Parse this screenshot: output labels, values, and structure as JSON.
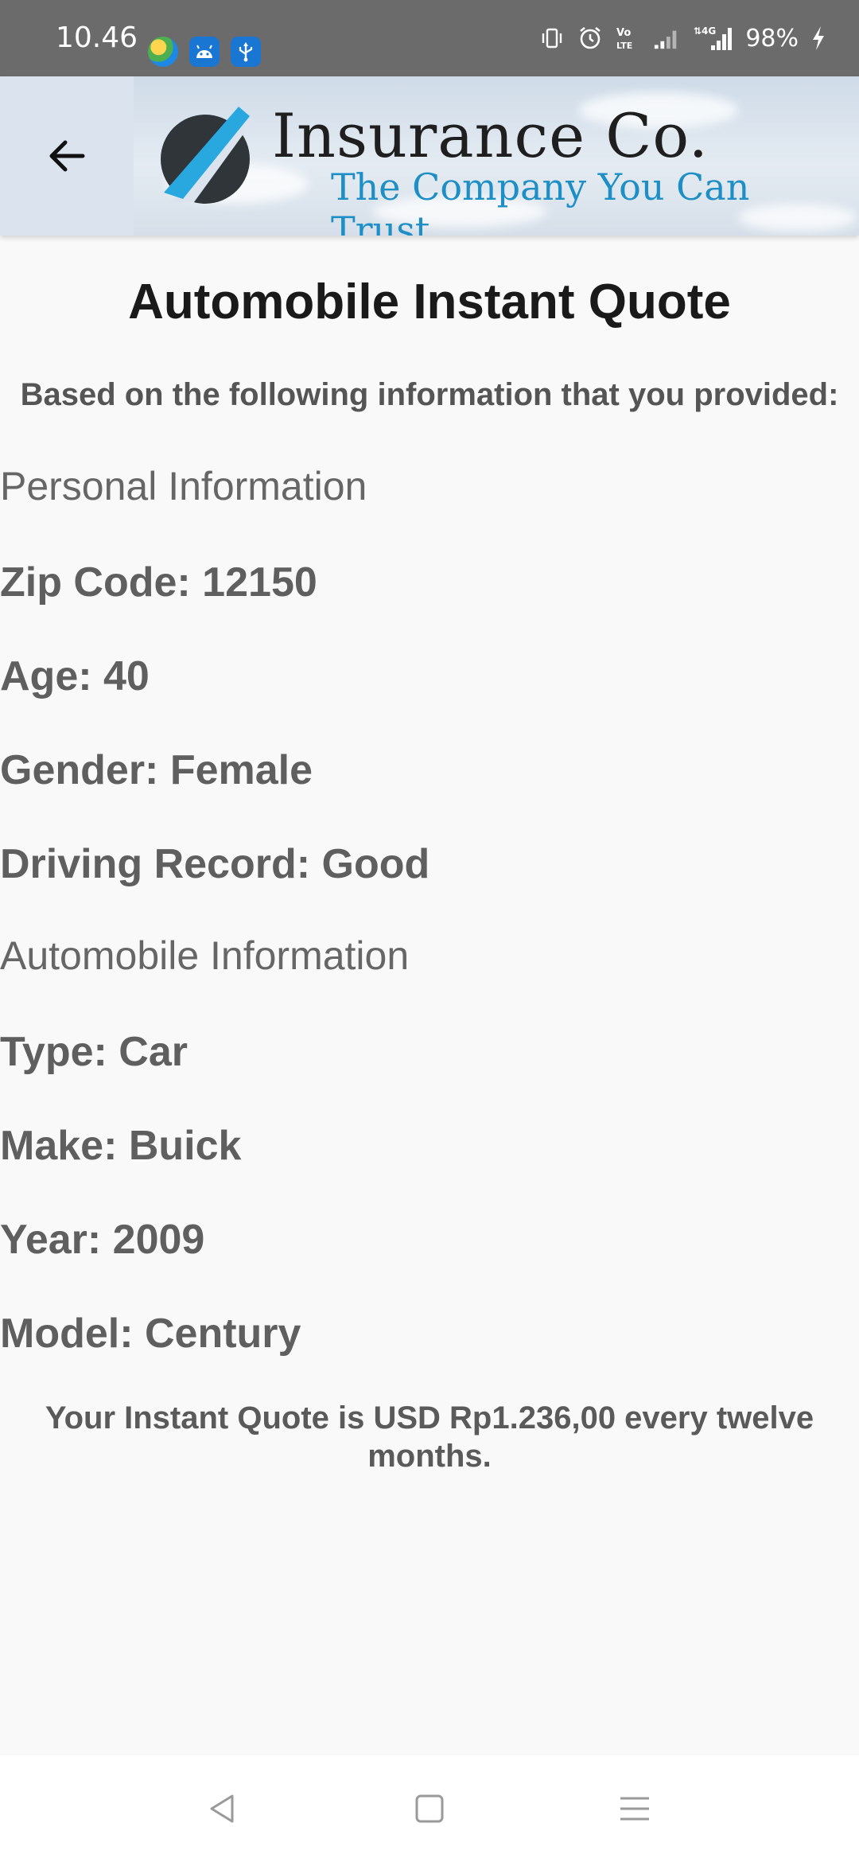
{
  "status_bar": {
    "time": "10.46",
    "battery": "98%",
    "app_icons": [
      "edge-icon",
      "android-icon",
      "usb-icon"
    ],
    "system_icons": [
      "vibrate-icon",
      "alarm-icon",
      "volte-icon",
      "signal-icon",
      "4g-signal-icon",
      "charging-icon"
    ]
  },
  "header": {
    "logo_title": "Insurance Co.",
    "logo_tagline": "The Company You Can Trust",
    "accent_color": "#1e8fc6"
  },
  "page": {
    "title": "Automobile Instant Quote",
    "subtitle": "Based on the following information that you provided:",
    "personal_heading": "Personal Information",
    "personal_fields": [
      "Zip Code: 12150",
      "Age: 40",
      "Gender: Female",
      "Driving Record: Good"
    ],
    "automobile_heading": "Automobile Information",
    "automobile_fields": [
      "Type: Car",
      "Make: Buick",
      "Year: 2009",
      "Model: Century"
    ],
    "quote": "Your Instant Quote is USD Rp1.236,00 every twelve months."
  },
  "nav_bar": {
    "buttons": [
      "back-triangle-icon",
      "home-square-icon",
      "recents-menu-icon"
    ]
  }
}
